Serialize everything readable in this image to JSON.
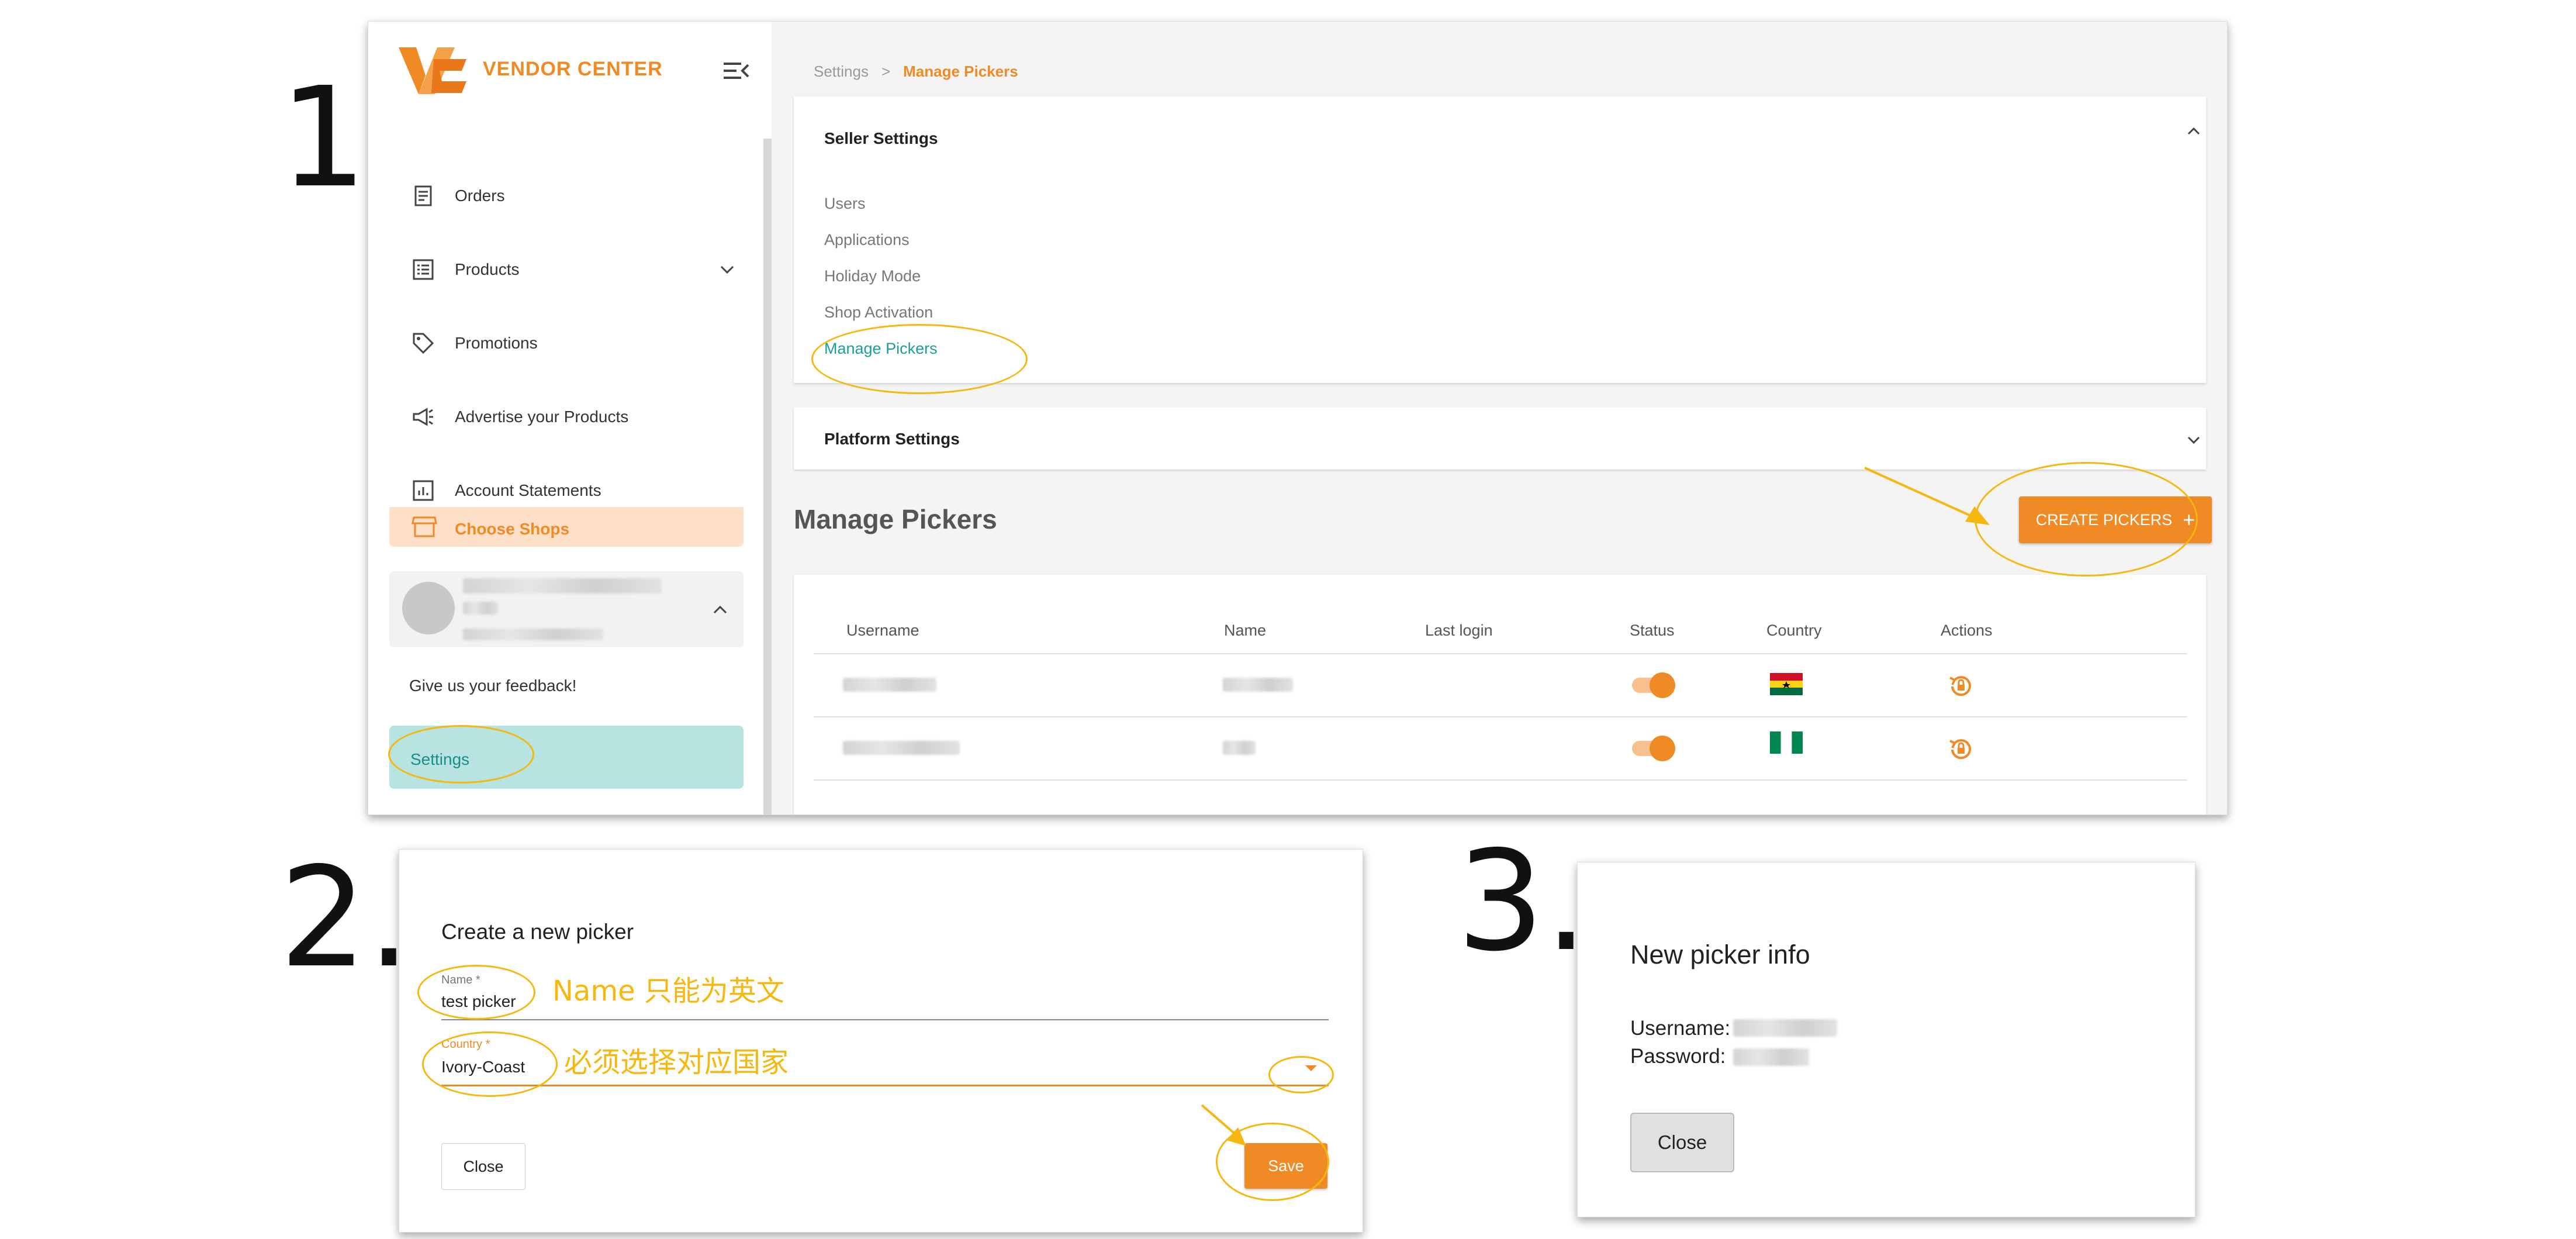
{
  "steps": [
    "1.",
    "2.",
    "3."
  ],
  "colors": {
    "accent": "#f08a24",
    "teal": "#1b9e9a",
    "annotation": "#f6b70f"
  },
  "sidebar": {
    "brand": "VENDOR CENTER",
    "items": [
      {
        "label": "Orders",
        "icon": "receipt-icon"
      },
      {
        "label": "Products",
        "icon": "list-icon"
      },
      {
        "label": "Promotions",
        "icon": "tag-icon"
      },
      {
        "label": "Advertise your Products",
        "icon": "megaphone-icon"
      },
      {
        "label": "Account Statements",
        "icon": "chart-icon"
      }
    ],
    "choose_shops": "Choose Shops",
    "feedback": "Give us your feedback!",
    "settings": "Settings"
  },
  "breadcrumb": {
    "parent": "Settings",
    "separator": ">",
    "current": "Manage Pickers"
  },
  "seller_settings": {
    "title": "Seller Settings",
    "links": [
      "Users",
      "Applications",
      "Holiday Mode",
      "Shop Activation",
      "Manage Pickers"
    ]
  },
  "platform_settings": {
    "title": "Platform Settings"
  },
  "manage_pickers": {
    "title": "Manage Pickers",
    "create_button": "CREATE PICKERS",
    "columns": [
      "Username",
      "Name",
      "Last login",
      "Status",
      "Country",
      "Actions"
    ],
    "rows": [
      {
        "status_on": true,
        "country_flag": "ghana-flag"
      },
      {
        "status_on": true,
        "country_flag": "nigeria-flag"
      }
    ]
  },
  "create_dialog": {
    "title": "Create a new picker",
    "name_label": "Name *",
    "name_value": "test picker",
    "name_note": "Name 只能为英文",
    "country_label": "Country *",
    "country_value": "Ivory-Coast",
    "country_note": "必须选择对应国家",
    "close": "Close",
    "save": "Save"
  },
  "info_dialog": {
    "title": "New picker info",
    "username_label": "Username:",
    "password_label": "Password:",
    "close": "Close"
  }
}
